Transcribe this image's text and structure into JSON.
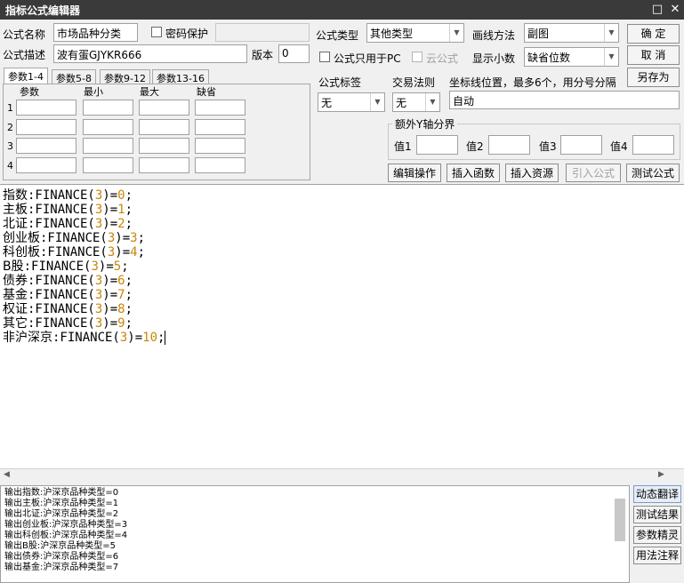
{
  "window": {
    "title": "指标公式编辑器",
    "max_icon": "□",
    "close_icon": "✕"
  },
  "form": {
    "name_label": "公式名称",
    "name_value": "市场品种分类",
    "password_label": "密码保护",
    "desc_label": "公式描述",
    "desc_value": "波有蛋GJYKR666",
    "version_label": "版本",
    "version_value": "0",
    "type_label": "公式类型",
    "type_value": "其他类型",
    "draw_label": "画线方法",
    "draw_value": "副图",
    "pc_only_label": "公式只用于PC",
    "cloud_label": "云公式",
    "decimals_label": "显示小数",
    "decimals_value": "缺省位数",
    "tag_label": "公式标签",
    "tag_value": "无",
    "trade_label": "交易法则",
    "trade_value": "无",
    "coord_label": "坐标线位置，最多6个，用分号分隔",
    "coord_value": "自动",
    "yaxis_label": "额外Y轴分界",
    "val_labels": [
      "值1",
      "值2",
      "值3",
      "值4"
    ]
  },
  "buttons": {
    "ok": "确  定",
    "cancel": "取  消",
    "saveas": "另存为",
    "edit_ops": "编辑操作",
    "insert_func": "插入函数",
    "insert_res": "插入资源",
    "import_formula": "引入公式",
    "test_formula": "测试公式"
  },
  "tabs": [
    "参数1-4",
    "参数5-8",
    "参数9-12",
    "参数13-16"
  ],
  "param_headers": [
    "参数",
    "最小",
    "最大",
    "缺省"
  ],
  "param_rows": [
    "1",
    "2",
    "3",
    "4"
  ],
  "code_lines": [
    {
      "name": "指数",
      "expr": ":FINANCE(",
      "arg": "3",
      "mid": ")=",
      "val": "0"
    },
    {
      "name": "主板",
      "expr": ":FINANCE(",
      "arg": "3",
      "mid": ")=",
      "val": "1"
    },
    {
      "name": "北证",
      "expr": ":FINANCE(",
      "arg": "3",
      "mid": ")=",
      "val": "2"
    },
    {
      "name": "创业板",
      "expr": ":FINANCE(",
      "arg": "3",
      "mid": ")=",
      "val": "3"
    },
    {
      "name": "科创板",
      "expr": ":FINANCE(",
      "arg": "3",
      "mid": ")=",
      "val": "4"
    },
    {
      "name": "B股",
      "expr": ":FINANCE(",
      "arg": "3",
      "mid": ")=",
      "val": "5"
    },
    {
      "name": "债券",
      "expr": ":FINANCE(",
      "arg": "3",
      "mid": ")=",
      "val": "6"
    },
    {
      "name": "基金",
      "expr": ":FINANCE(",
      "arg": "3",
      "mid": ")=",
      "val": "7"
    },
    {
      "name": "权证",
      "expr": ":FINANCE(",
      "arg": "3",
      "mid": ")=",
      "val": "8"
    },
    {
      "name": "其它",
      "expr": ":FINANCE(",
      "arg": "3",
      "mid": ")=",
      "val": "9"
    },
    {
      "name": "非沪深京",
      "expr": ":FINANCE(",
      "arg": "3",
      "mid": ")=",
      "val": "10"
    }
  ],
  "output_lines": [
    "输出指数:沪深京品种类型=0",
    "输出主板:沪深京品种类型=1",
    "输出北证:沪深京品种类型=2",
    "输出创业板:沪深京品种类型=3",
    "输出科创板:沪深京品种类型=4",
    "输出B股:沪深京品种类型=5",
    "输出债券:沪深京品种类型=6",
    "输出基金:沪深京品种类型=7"
  ],
  "side_buttons": [
    "动态翻译",
    "测试结果",
    "参数精灵",
    "用法注释"
  ]
}
